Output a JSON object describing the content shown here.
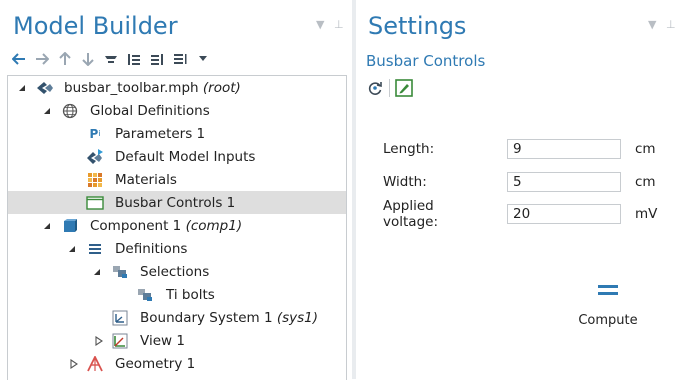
{
  "left_panel": {
    "title": "Model Builder"
  },
  "right_panel": {
    "title": "Settings",
    "subtitle": "Busbar Controls"
  },
  "toolbar_icons": [
    "back-arrow-icon",
    "forward-arrow-icon",
    "up-arrow-icon",
    "down-arrow-icon",
    "show-icon",
    "collapse-all-icon",
    "expand-all-icon",
    "list-icon",
    "dropdown-icon"
  ],
  "tree": {
    "root": {
      "label": "busbar_toolbar.mph",
      "tag": "(root)"
    },
    "global_definitions": {
      "label": "Global Definitions"
    },
    "parameters": {
      "label": "Parameters 1"
    },
    "default_model_inputs": {
      "label": "Default Model Inputs"
    },
    "materials": {
      "label": "Materials"
    },
    "busbar_controls": {
      "label": "Busbar Controls 1"
    },
    "component": {
      "label": "Component 1",
      "tag": "(comp1)"
    },
    "definitions": {
      "label": "Definitions"
    },
    "selections": {
      "label": "Selections"
    },
    "ti_bolts": {
      "label": "Ti bolts"
    },
    "boundary_system": {
      "label": "Boundary System 1",
      "tag": "(sys1)"
    },
    "view": {
      "label": "View 1"
    },
    "geometry": {
      "label": "Geometry 1"
    }
  },
  "fields": [
    {
      "label": "Length:",
      "value": "9",
      "unit": "cm"
    },
    {
      "label": "Width:",
      "value": "5",
      "unit": "cm"
    },
    {
      "label": "Applied voltage:",
      "value": "20",
      "unit": "mV"
    }
  ],
  "compute": {
    "label": "Compute"
  },
  "colors": {
    "title_blue": "#2f7ab3",
    "selection_bg": "#dedede",
    "divider": "#e9ecef"
  }
}
